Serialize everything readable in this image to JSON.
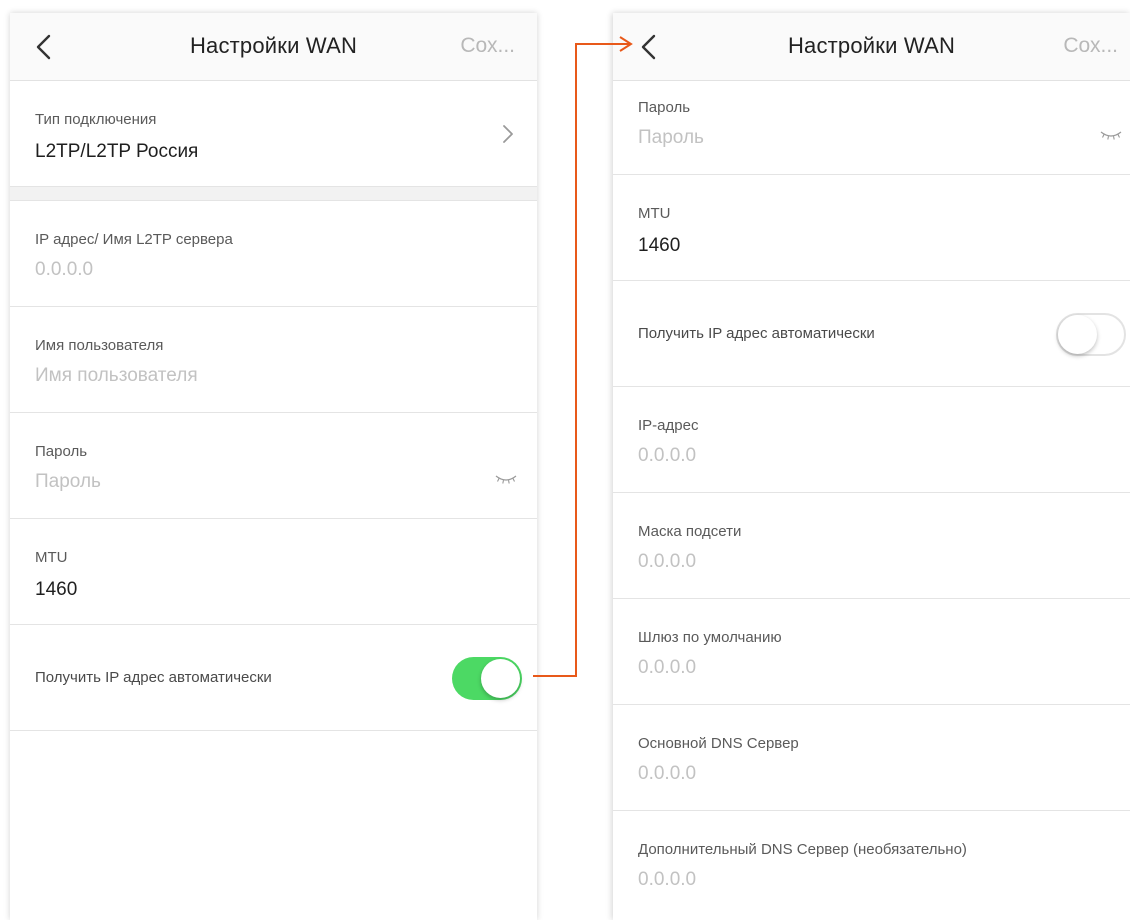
{
  "accent_color": "#4cd964",
  "annotation_color": "#e8591a",
  "left_screen": {
    "navbar": {
      "back_icon": "chevron-left-icon",
      "title": "Настройки WAN",
      "save_label": "Сох..."
    },
    "connection_type": {
      "label": "Тип подключения",
      "value": "L2TP/L2TP Россия",
      "icon": "chevron-right-icon"
    },
    "server": {
      "label": "IP адрес/ Имя L2TP сервера",
      "placeholder": "0.0.0.0"
    },
    "username": {
      "label": "Имя пользователя",
      "placeholder": "Имя пользователя"
    },
    "password": {
      "label": "Пароль",
      "placeholder": "Пароль",
      "icon": "eye-closed-icon"
    },
    "mtu": {
      "label": "MTU",
      "value": "1460"
    },
    "auto_ip": {
      "label": "Получить IP адрес автоматически",
      "enabled": true
    }
  },
  "right_screen": {
    "navbar": {
      "back_icon": "chevron-left-icon",
      "title": "Настройки WAN",
      "save_label": "Сох..."
    },
    "password": {
      "label": "Пароль",
      "placeholder": "Пароль",
      "icon": "eye-closed-icon"
    },
    "mtu": {
      "label": "MTU",
      "value": "1460"
    },
    "auto_ip": {
      "label": "Получить IP адрес автоматически",
      "enabled": false
    },
    "ip_address": {
      "label": "IP-адрес",
      "placeholder": "0.0.0.0"
    },
    "subnet_mask": {
      "label": "Маска подсети",
      "placeholder": "0.0.0.0"
    },
    "gateway": {
      "label": "Шлюз по умолчанию",
      "placeholder": "0.0.0.0"
    },
    "primary_dns": {
      "label": "Основной DNS Сервер",
      "placeholder": "0.0.0.0"
    },
    "secondary_dns": {
      "label": "Дополнительный DNS Сервер (необязательно)",
      "placeholder": "0.0.0.0"
    }
  }
}
